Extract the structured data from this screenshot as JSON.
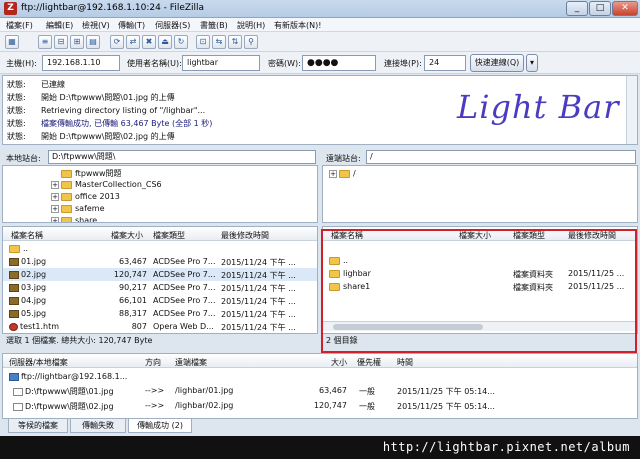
{
  "window": {
    "title": "ftp://lightbar@192.168.1.10:24 - FileZilla",
    "app_icon": "Z"
  },
  "menu": [
    "檔案(F)",
    "編輯(E)",
    "檢視(V)",
    "傳輸(T)",
    "伺服器(S)",
    "書籤(B)",
    "說明(H)",
    "有新版本(N)!"
  ],
  "quickconnect": {
    "host_label": "主機(H):",
    "host": "192.168.1.10",
    "user_label": "使用者名稱(U):",
    "user": "lightbar",
    "pass_label": "密碼(W):",
    "pass": "●●●●",
    "port_label": "連接埠(P):",
    "port": "24",
    "connect_label": "快速連線(Q)",
    "dropdown": "▾"
  },
  "log": [
    {
      "label": "狀態:",
      "msg": "已連線"
    },
    {
      "label": "狀態:",
      "msg": "開始 D:\\ftpwww\\問題\\01.jpg 的上傳"
    },
    {
      "label": "狀態:",
      "msg": "Retrieving directory listing of \"/lighbar\"..."
    },
    {
      "label": "狀態:",
      "msg": "檔案傳輸成功, 已傳輸 63,467 Byte (全部 1 秒)"
    },
    {
      "label": "狀態:",
      "msg": "開始 D:\\ftpwww\\問題\\02.jpg 的上傳"
    }
  ],
  "logo_text": "Light Bar",
  "local": {
    "path_label": "本地站台:",
    "path": "D:\\ftpwww\\問題\\",
    "tree": [
      "ftpwww問題",
      "MasterCollection_CS6",
      "office 2013",
      "safeme",
      "share"
    ],
    "headers": {
      "name": "檔案名稱",
      "size": "檔案大小",
      "type": "檔案類型",
      "modified": "最後修改時間"
    },
    "files": [
      {
        "name": "..",
        "size": "",
        "type": "",
        "modified": ""
      },
      {
        "name": "01.jpg",
        "size": "63,467",
        "type": "ACDSee Pro 7...",
        "modified": "2015/11/24 下午 ..."
      },
      {
        "name": "02.jpg",
        "size": "120,747",
        "type": "ACDSee Pro 7...",
        "modified": "2015/11/24 下午 ..."
      },
      {
        "name": "03.jpg",
        "size": "90,217",
        "type": "ACDSee Pro 7...",
        "modified": "2015/11/24 下午 ..."
      },
      {
        "name": "04.jpg",
        "size": "66,101",
        "type": "ACDSee Pro 7...",
        "modified": "2015/11/24 下午 ..."
      },
      {
        "name": "05.jpg",
        "size": "88,317",
        "type": "ACDSee Pro 7...",
        "modified": "2015/11/24 下午 ..."
      },
      {
        "name": "test1.htm",
        "size": "807",
        "type": "Opera Web D...",
        "modified": "2015/11/24 下午 ..."
      }
    ],
    "status": "選取 1 個檔案. 總共大小: 120,747 Byte"
  },
  "remote": {
    "path_label": "遠端站台:",
    "path": "/",
    "tree": [
      "/"
    ],
    "headers": {
      "name": "檔案名稱",
      "size": "檔案大小",
      "type": "檔案類型",
      "modified": "最後修改時間"
    },
    "files": [
      {
        "name": "..",
        "size": "",
        "type": "",
        "modified": ""
      },
      {
        "name": "lighbar",
        "size": "",
        "type": "檔案資料夾",
        "modified": "2015/11/25 ..."
      },
      {
        "name": "share1",
        "size": "",
        "type": "檔案資料夾",
        "modified": "2015/11/25 ..."
      }
    ],
    "status": "2 個目錄"
  },
  "queue": {
    "headers": {
      "server": "伺服器/本地檔案",
      "direction": "方向",
      "remote": "遠端檔案",
      "size": "大小",
      "priority": "優先權",
      "time": "時間"
    },
    "server": "ftp://lightbar@192.168.1...",
    "items": [
      {
        "local": "D:\\ftpwww\\問題\\01.jpg",
        "direction": "-->>",
        "remote": "/lighbar/01.jpg",
        "size": "63,467",
        "priority": "一般",
        "time": "2015/11/25 下午 05:14..."
      },
      {
        "local": "D:\\ftpwww\\問題\\02.jpg",
        "direction": "-->>",
        "remote": "/lighbar/02.jpg",
        "size": "120,747",
        "priority": "一般",
        "time": "2015/11/25 下午 05:14..."
      }
    ]
  },
  "tabs": [
    "等候的檔案",
    "傳輸失敗",
    "傳輸成功 (2)"
  ],
  "watermark": "http://lightbar.pixnet.net/album",
  "colors": {
    "highlight_box": "#d0202c",
    "logo": "#4a3cc0",
    "log_text": "#1a1a7a"
  },
  "icons": [
    "filezilla-icon",
    "site-manager-icon",
    "refresh-icon",
    "process-queue-icon",
    "cancel-icon",
    "disconnect-icon",
    "reconnect-icon",
    "filter-icon",
    "compare-icon",
    "sync-browse-icon",
    "search-icon"
  ]
}
